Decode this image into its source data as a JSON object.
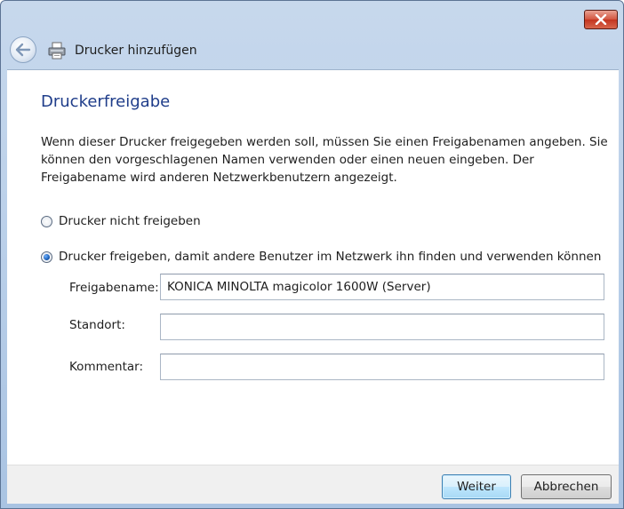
{
  "window": {
    "close_icon": "close-icon"
  },
  "nav": {
    "title": "Drucker hinzufügen",
    "back_icon": "back-arrow-icon",
    "printer_icon": "printer-icon"
  },
  "main": {
    "heading": "Druckerfreigabe",
    "description": "Wenn dieser Drucker freigegeben werden soll, müssen Sie einen Freigabenamen angeben. Sie können den vorgeschlagenen Namen verwenden oder einen neuen eingeben. Der Freigabename wird anderen Netzwerkbenutzern angezeigt.",
    "options": [
      {
        "label": "Drucker nicht freigeben",
        "checked": false
      },
      {
        "label": "Drucker freigeben, damit andere Benutzer im Netzwerk ihn finden und verwenden können",
        "checked": true
      }
    ],
    "fields": {
      "share_name": {
        "label": "Freigabename:",
        "value": "KONICA MINOLTA magicolor 1600W (Server)"
      },
      "location": {
        "label": "Standort:",
        "value": ""
      },
      "comment": {
        "label": "Kommentar:",
        "value": ""
      }
    }
  },
  "footer": {
    "next_label": "Weiter",
    "cancel_label": "Abbrechen"
  }
}
